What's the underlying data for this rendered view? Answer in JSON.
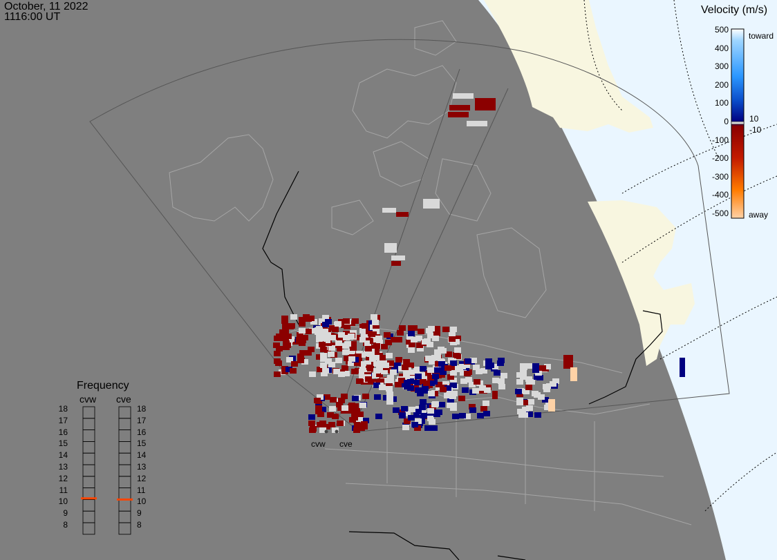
{
  "header": {
    "date": "October, 11 2022",
    "time": "1116:00 UT"
  },
  "colorbar": {
    "title": "Velocity (m/s)",
    "ticks": [
      "500",
      "400",
      "300",
      "200",
      "100",
      "0",
      "-100",
      "-200",
      "-300",
      "-400",
      "-500"
    ],
    "toward_label": "toward",
    "away_label": "away",
    "inner_labels": [
      "10",
      "-10"
    ],
    "stops": [
      "#ffffff",
      "#9fd6ff",
      "#2b97ff",
      "#0a4cc9",
      "#000080",
      "#8b0000",
      "#c21a00",
      "#ff7b00",
      "#ffd2a6"
    ]
  },
  "frequency": {
    "title": "Frequency",
    "radars": [
      "cvw",
      "cve"
    ],
    "levels": [
      "18",
      "17",
      "16",
      "15",
      "14",
      "13",
      "12",
      "11",
      "10",
      "9",
      "8"
    ],
    "current_mhz": [
      10.6,
      10.5
    ],
    "marker_color": "#ff4500"
  },
  "radar_sites": [
    "cvw",
    "cve"
  ],
  "colors": {
    "night": "#7f7f7f",
    "ocean": "#eaf6ff",
    "land_day": "#f8f6e0",
    "ground_scatter": "#d9d9d9",
    "toward": "#000080",
    "away": "#8b0000"
  }
}
